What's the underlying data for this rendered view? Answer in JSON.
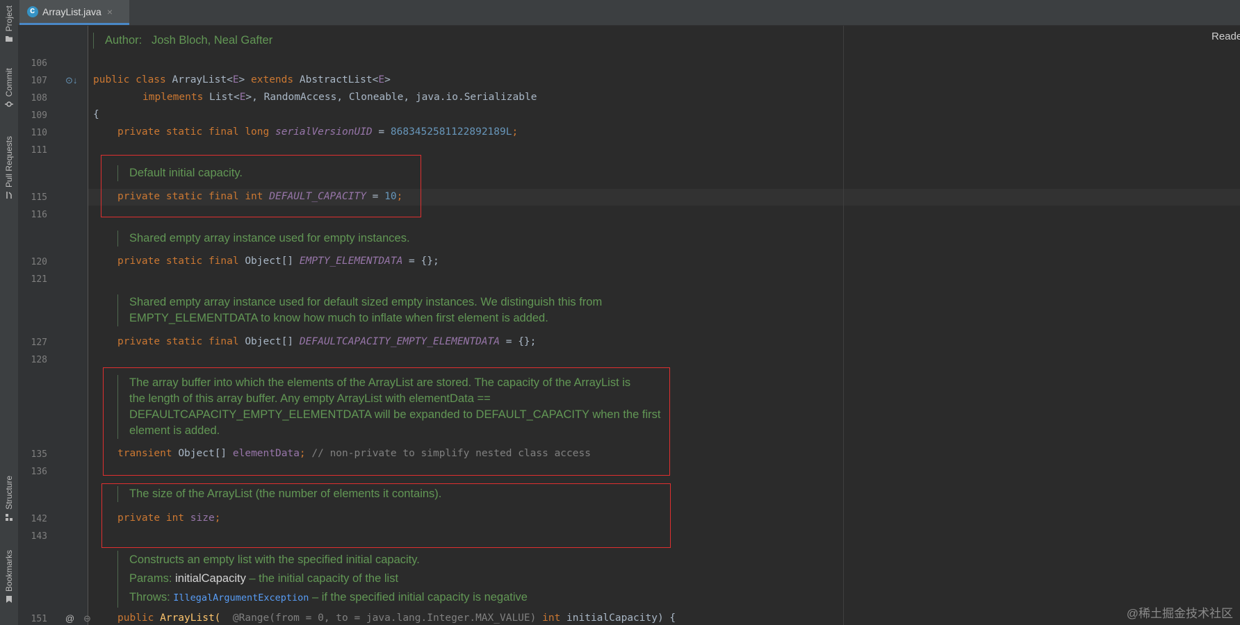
{
  "sidebar": {
    "project": "Project",
    "commit": "Commit",
    "pull_requests": "Pull Requests",
    "structure": "Structure",
    "bookmarks": "Bookmarks"
  },
  "tab": {
    "title": "ArrayList.java",
    "close": "×"
  },
  "reader_label": "Reade",
  "author_doc": {
    "label": "Author:",
    "value": "Josh Bloch, Neal Gafter"
  },
  "line_numbers": {
    "l106": "106",
    "l107": "107",
    "l108": "108",
    "l109": "109",
    "l110": "110",
    "l111": "111",
    "l115": "115",
    "l116": "116",
    "l120": "120",
    "l121": "121",
    "l127": "127",
    "l128": "128",
    "l135": "135",
    "l136": "136",
    "l142": "142",
    "l143": "143",
    "l151": "151"
  },
  "code": {
    "l107": {
      "kw1": "public class ",
      "name": "ArrayList<",
      "tp": "E",
      "mid": "> ",
      "kw2": "extends ",
      "sup": "AbstractList<",
      "tp2": "E",
      "end": ">"
    },
    "l108": {
      "kw": "implements ",
      "t1": "List<",
      "tp": "E",
      "t2": ">, RandomAccess, Cloneable, java.io.Serializable"
    },
    "l109": "{",
    "l110": {
      "kw": "private static final long ",
      "fld": "serialVersionUID",
      "eq": " = ",
      "num": "8683452581122892189L",
      "end": ";"
    },
    "l115": {
      "kw": "private static final int ",
      "fld": "DEFAULT_CAPACITY",
      "eq": " = ",
      "num": "10",
      "end": ";"
    },
    "l120": {
      "kw": "private static final ",
      "type": "Object[] ",
      "fld": "EMPTY_ELEMENTDATA",
      "rest": " = {};"
    },
    "l127": {
      "kw": "private static final ",
      "type": "Object[] ",
      "fld": "DEFAULTCAPACITY_EMPTY_ELEMENTDATA",
      "rest": " = {};"
    },
    "l135": {
      "kw": "transient ",
      "type": "Object[] ",
      "field": "elementData",
      "semi": "; ",
      "cmt": "// non-private to simplify nested class access"
    },
    "l142": {
      "kw": "private int ",
      "field": "size",
      "semi": ";"
    },
    "l151": {
      "kw": "public ",
      "name": "ArrayList(",
      "ann": "  @Range(from = 0, to = java.lang.Integer.MAX_VALUE)",
      "kw2": " int ",
      "param": "initialCapacity) {"
    }
  },
  "docs": {
    "default_capacity": "Default initial capacity.",
    "empty_elementdata": "Shared empty array instance used for empty instances.",
    "default_empty_1": "Shared empty array instance used for default sized empty instances. We distinguish this from",
    "default_empty_2": "EMPTY_ELEMENTDATA to know how much to inflate when first element is added.",
    "element_data_1": "The array buffer into which the elements of the ArrayList are stored. The capacity of the ArrayList is",
    "element_data_2": "the length of this array buffer. Any empty ArrayList with elementData ==",
    "element_data_3": "DEFAULTCAPACITY_EMPTY_ELEMENTDATA will be expanded to DEFAULT_CAPACITY when the first",
    "element_data_4": "element is added.",
    "size": "The size of the ArrayList (the number of elements it contains).",
    "ctor_1": "Constructs an empty list with the specified initial capacity.",
    "ctor_params_label": "Params:",
    "ctor_params_name": "initialCapacity",
    "ctor_params_desc": " – the initial capacity of the list",
    "ctor_throws_label": "Throws:",
    "ctor_throws_ex": "IllegalArgumentException",
    "ctor_throws_desc": " – if the specified initial capacity is negative"
  },
  "gutter_icons": {
    "l107": "⊙↓",
    "l151_at": "@",
    "l151_fold": "⊖"
  },
  "watermark": "@稀土掘金技术社区"
}
